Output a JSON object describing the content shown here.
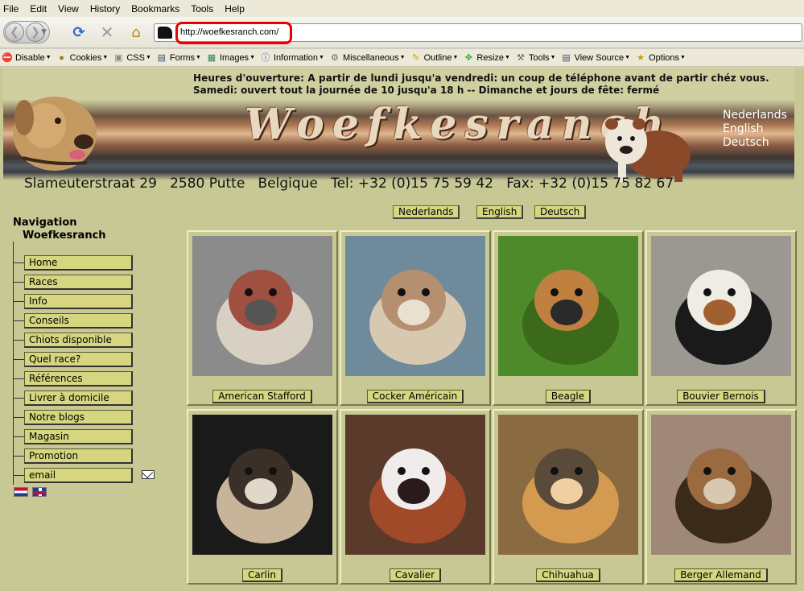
{
  "browser": {
    "menu": [
      "File",
      "Edit",
      "View",
      "History",
      "Bookmarks",
      "Tools",
      "Help"
    ],
    "url": "http://woefkesranch.com/",
    "devbar": [
      {
        "label": "Disable",
        "icon": "disable-icon"
      },
      {
        "label": "Cookies",
        "icon": "cookies-icon"
      },
      {
        "label": "CSS",
        "icon": "css-icon"
      },
      {
        "label": "Forms",
        "icon": "forms-icon"
      },
      {
        "label": "Images",
        "icon": "images-icon"
      },
      {
        "label": "Information",
        "icon": "information-icon"
      },
      {
        "label": "Miscellaneous",
        "icon": "miscellaneous-icon"
      },
      {
        "label": "Outline",
        "icon": "outline-icon"
      },
      {
        "label": "Resize",
        "icon": "resize-icon"
      },
      {
        "label": "Tools",
        "icon": "tools-icon"
      },
      {
        "label": "View Source",
        "icon": "view-source-icon"
      },
      {
        "label": "Options",
        "icon": "options-icon"
      }
    ]
  },
  "banner": {
    "hours_line1": "Heures d'ouverture: A partir de  lundi jusqu'a vendredi: un coup de téléphone avant de partir chéz vous.",
    "hours_line2": "Samedi: ouvert tout la journée de 10 jusqu'a 18 h      --   Dimanche et jours de fête: fermé",
    "title": "Woefkesranch",
    "languages": [
      "Nederlands",
      "English",
      "Deutsch"
    ],
    "address": "Slameuterstraat 29   2580 Putte   Belgique   Tel: +32 (0)15 75 59 42   Fax: +32 (0)15 75 82 67"
  },
  "language_buttons": [
    "Nederlands",
    "English",
    "Deutsch"
  ],
  "navigation": {
    "title_line1": "Navigation",
    "title_line2": "Woefkesranch",
    "items": [
      "Home",
      "Races",
      "Info",
      "Conseils",
      "Chiots disponible",
      "Quel race?",
      "Références",
      "Livrer à domicile",
      "Notre blogs",
      "Magasin",
      "Promotion",
      "email"
    ]
  },
  "gallery": [
    {
      "label": "American Stafford"
    },
    {
      "label": "Cocker Américain"
    },
    {
      "label": "Beagle"
    },
    {
      "label": "Bouvier Bernois"
    },
    {
      "label": "Carlin"
    },
    {
      "label": "Cavalier"
    },
    {
      "label": "Chihuahua"
    },
    {
      "label": "Berger Allemand"
    }
  ],
  "colors": {
    "page_bg": "#c8c895",
    "button_bg": "#d6d680",
    "url_highlight": "#ee0000"
  }
}
